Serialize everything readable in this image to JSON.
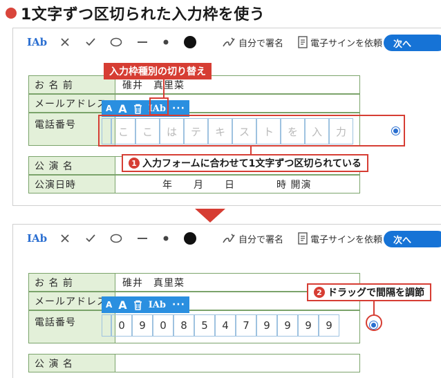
{
  "heading": "1文字ずつ区切られた入力枠を使う",
  "toolbar": {
    "text_field_glyph": "IAb",
    "sign_label": "自分で署名",
    "request_label": "電子サインを依頼",
    "next_label": "次へ"
  },
  "mini_toolbar": {
    "small_a": "A",
    "large_a": "A",
    "field_glyph": "IAb",
    "more": "···"
  },
  "form_top": {
    "rows": [
      {
        "label": "お 名 前",
        "value": "碓井　真里菜"
      },
      {
        "label": "メールアドレス",
        "value": ""
      },
      {
        "label": "電話番号",
        "value": ""
      },
      {
        "label": "公 演 名",
        "value": ""
      },
      {
        "label": "公演日時",
        "value": "年　　月　　日　　　　時 開演"
      }
    ],
    "placeholder_chars": [
      "こ",
      "こ",
      "は",
      "テ",
      "キ",
      "ス",
      "ト",
      "を",
      "入",
      "力"
    ]
  },
  "form_bottom": {
    "rows": [
      {
        "label": "お 名 前",
        "value": "碓井　真里菜"
      },
      {
        "label": "メールアドレス",
        "value": ""
      },
      {
        "label": "電話番号",
        "value": ""
      },
      {
        "label": "公 演 名",
        "value": ""
      }
    ],
    "digits": [
      "0",
      "9",
      "0",
      "8",
      "5",
      "4",
      "7",
      "9",
      "9",
      "9",
      "9"
    ]
  },
  "callouts": {
    "switch_type": "入力枠種別の切り替え",
    "note1_num": "1",
    "note1": "入力フォームに合わせて1文字ずつ区切られている",
    "note2_num": "2",
    "note2": "ドラッグで間隔を調節"
  },
  "colors": {
    "accent_red": "#d63d33",
    "toolbar_blue": "#2a8fe0",
    "label_green": "#e3f0d9"
  }
}
